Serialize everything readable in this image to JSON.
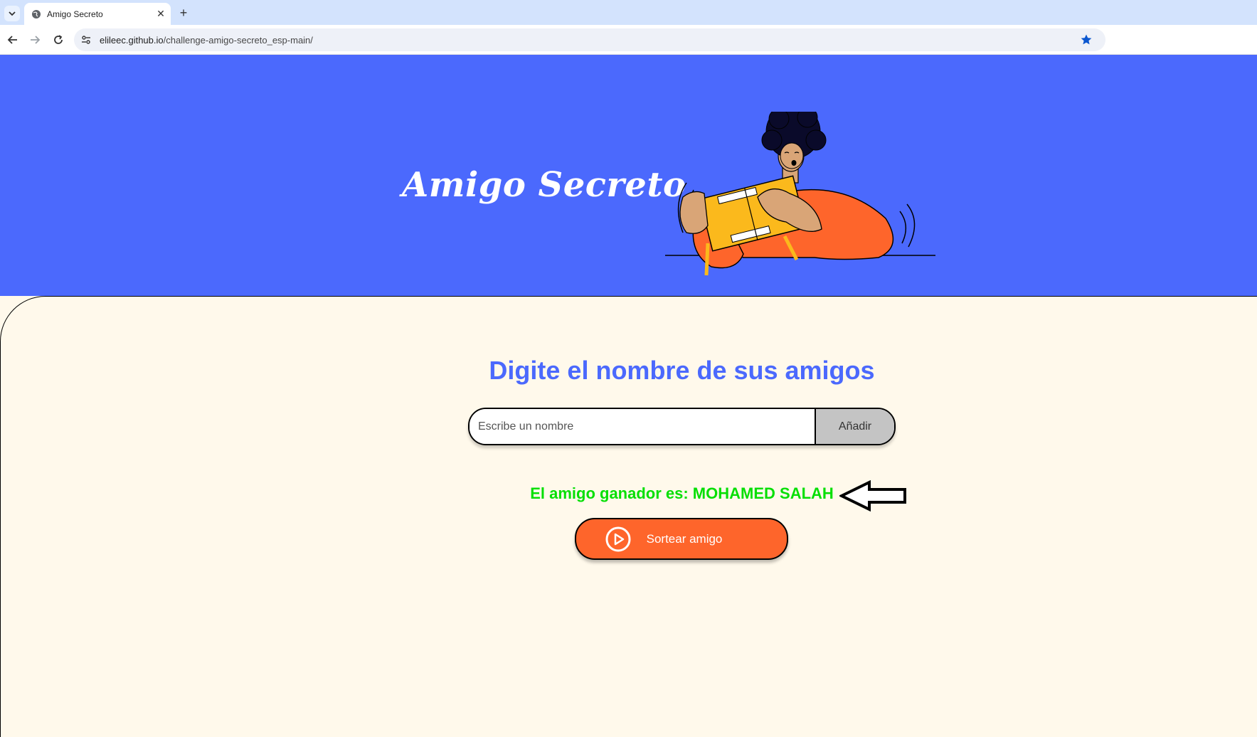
{
  "browser": {
    "tab_title": "Amigo Secreto",
    "url_host": "elileec.github.io",
    "url_path": "/challenge-amigo-secreto_esp-main/"
  },
  "header": {
    "title": "Amigo Secreto",
    "illustration": "person-holding-gift-illustration"
  },
  "main": {
    "section_title": "Digite el nombre de sus amigos",
    "input_placeholder": "Escribe un nombre",
    "add_label": "Añadir",
    "result_text": "El amigo ganador es: MOHAMED SALAH",
    "draw_label": "Sortear amigo"
  },
  "colors": {
    "hero_bg": "#4B69FD",
    "page_bg": "#FFF9EB",
    "accent_orange": "#FE652B",
    "result_green": "#05DF05",
    "title_blue": "#4B69FD"
  }
}
